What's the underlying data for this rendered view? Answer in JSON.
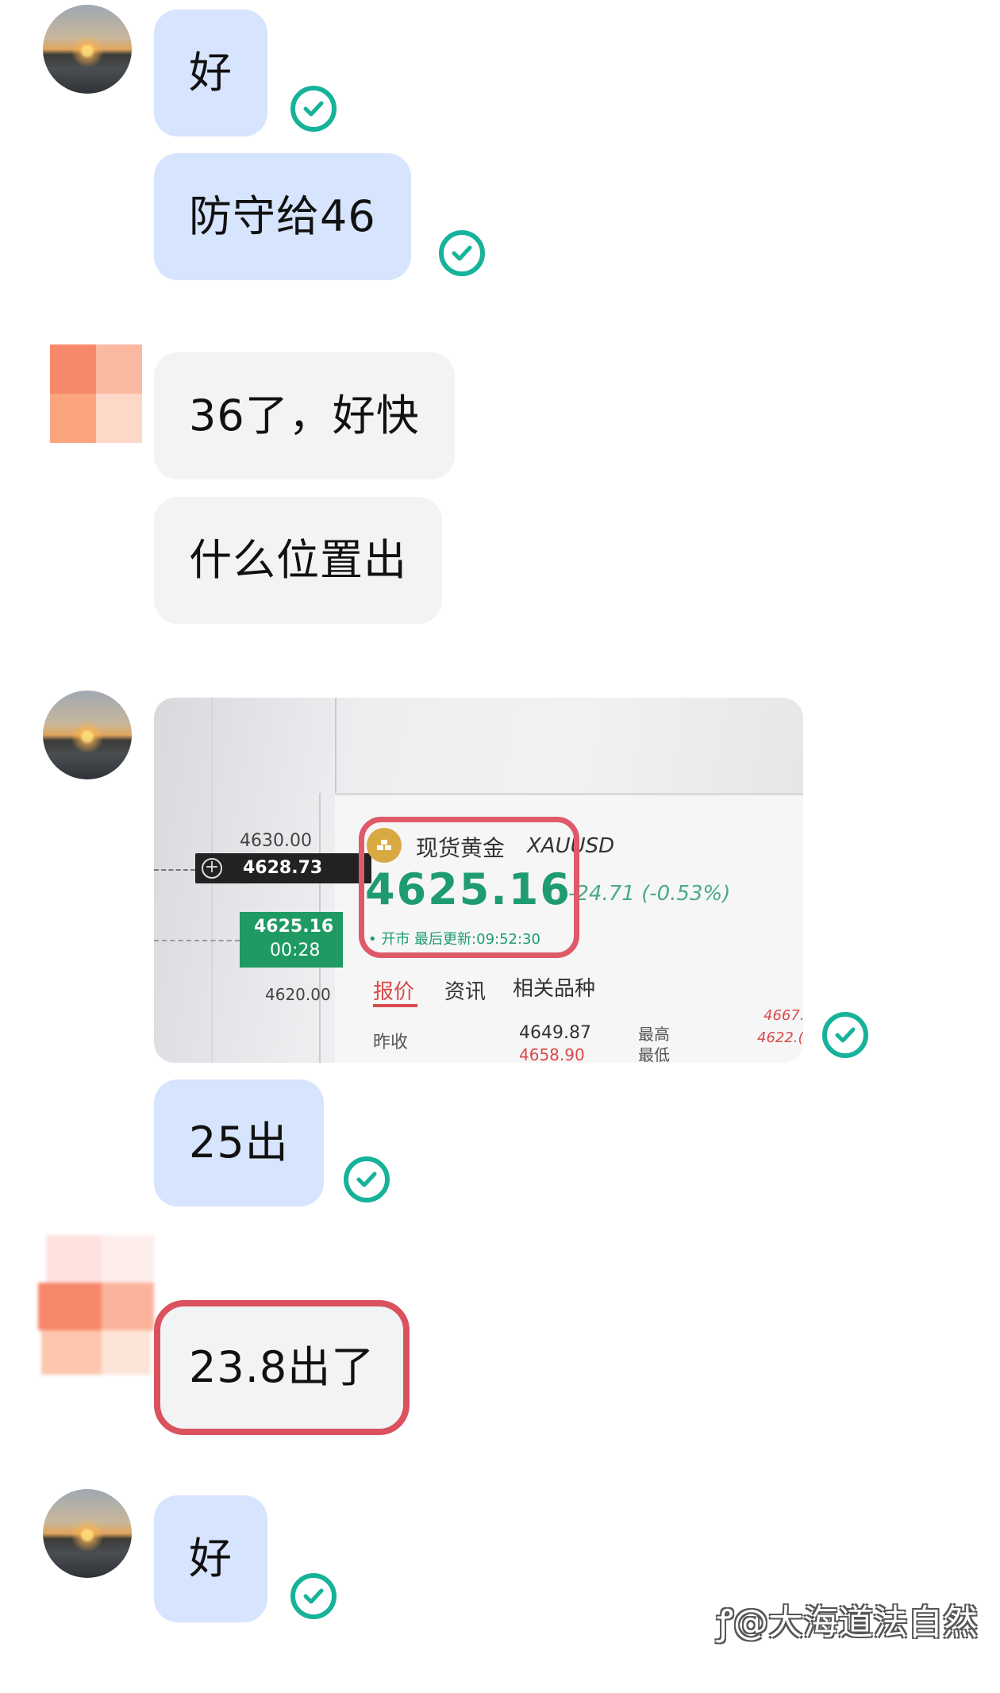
{
  "messages": [
    {
      "text": "好"
    },
    {
      "text": "防守给46"
    },
    {
      "text": "36了，好快"
    },
    {
      "text": "什么位置出"
    },
    {
      "text": "25出"
    },
    {
      "text": "23.8出了"
    },
    {
      "text": "好"
    }
  ],
  "screenshot": {
    "axis_labels": [
      "4630.00",
      "4620.00"
    ],
    "crosshair_price": "4628.73",
    "current_tag_price": "4625.16",
    "current_tag_time": "00:28",
    "instrument_name": "现货黄金",
    "instrument_code": "XAUUSD",
    "price": "4625.16",
    "change": "-24.71 (-0.53%)",
    "status": "• 开市 最后更新:09:52:30",
    "tabs": [
      "报价",
      "资讯",
      "相关品种"
    ],
    "row_label_1": "昨收",
    "row_value_1": "4649.87",
    "row_value_2": "4658.90",
    "row_label_high": "最高",
    "row_label_low": "最低",
    "right_value_1": "4667.",
    "right_value_2": "4622.("
  },
  "watermark": "@大海道法自然",
  "colors": {
    "outgoing_bubble": "#d6e4fd",
    "incoming_bubble": "#f2f3f5",
    "read_check": "#17b29a",
    "highlight_red": "#d9525d",
    "price_green": "#1e9c6f"
  }
}
